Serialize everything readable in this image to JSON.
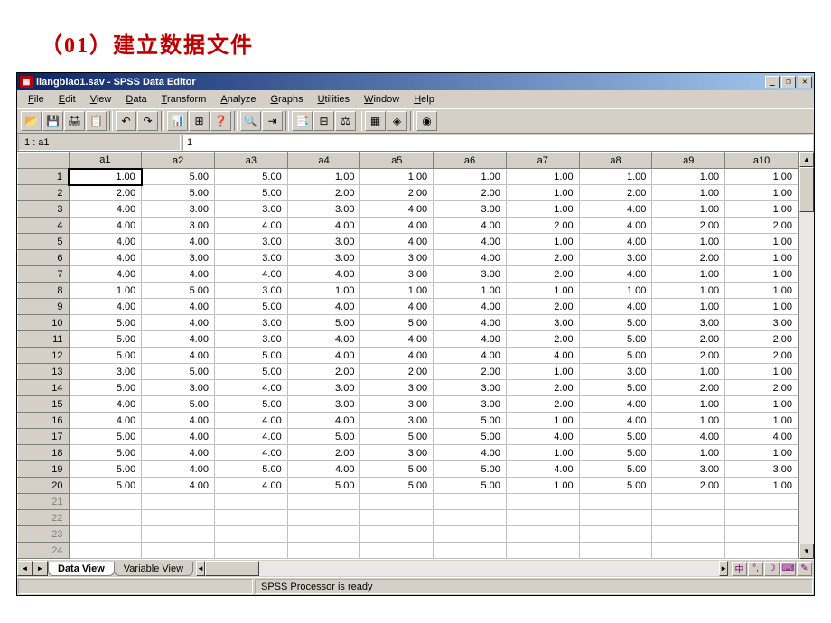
{
  "page_heading": "（01）建立数据文件",
  "window": {
    "title": "liangbiao1.sav - SPSS Data Editor",
    "buttons": {
      "min": "_",
      "max": "❐",
      "close": "✕"
    }
  },
  "menu": [
    "File",
    "Edit",
    "View",
    "Data",
    "Transform",
    "Analyze",
    "Graphs",
    "Utilities",
    "Window",
    "Help"
  ],
  "toolbar_icons": [
    "📂",
    "💾",
    "🖨",
    "📋",
    "↶",
    "↷",
    "📊",
    "⊞",
    "❓",
    "🔍",
    "⇥",
    "📑",
    "⊟",
    "⚖",
    "▦",
    "◈",
    "◉"
  ],
  "indicator": {
    "cell": "1 : a1",
    "value": "1"
  },
  "columns": [
    "a1",
    "a2",
    "a3",
    "a4",
    "a5",
    "a6",
    "a7",
    "a8",
    "a9",
    "a10"
  ],
  "rows": [
    [
      "1.00",
      "5.00",
      "5.00",
      "1.00",
      "1.00",
      "1.00",
      "1.00",
      "1.00",
      "1.00",
      "1.00"
    ],
    [
      "2.00",
      "5.00",
      "5.00",
      "2.00",
      "2.00",
      "2.00",
      "1.00",
      "2.00",
      "1.00",
      "1.00"
    ],
    [
      "4.00",
      "3.00",
      "3.00",
      "3.00",
      "4.00",
      "3.00",
      "1.00",
      "4.00",
      "1.00",
      "1.00"
    ],
    [
      "4.00",
      "3.00",
      "4.00",
      "4.00",
      "4.00",
      "4.00",
      "2.00",
      "4.00",
      "2.00",
      "2.00"
    ],
    [
      "4.00",
      "4.00",
      "3.00",
      "3.00",
      "4.00",
      "4.00",
      "1.00",
      "4.00",
      "1.00",
      "1.00"
    ],
    [
      "4.00",
      "3.00",
      "3.00",
      "3.00",
      "3.00",
      "4.00",
      "2.00",
      "3.00",
      "2.00",
      "1.00"
    ],
    [
      "4.00",
      "4.00",
      "4.00",
      "4.00",
      "3.00",
      "3.00",
      "2.00",
      "4.00",
      "1.00",
      "1.00"
    ],
    [
      "1.00",
      "5.00",
      "3.00",
      "1.00",
      "1.00",
      "1.00",
      "1.00",
      "1.00",
      "1.00",
      "1.00"
    ],
    [
      "4.00",
      "4.00",
      "5.00",
      "4.00",
      "4.00",
      "4.00",
      "2.00",
      "4.00",
      "1.00",
      "1.00"
    ],
    [
      "5.00",
      "4.00",
      "3.00",
      "5.00",
      "5.00",
      "4.00",
      "3.00",
      "5.00",
      "3.00",
      "3.00"
    ],
    [
      "5.00",
      "4.00",
      "3.00",
      "4.00",
      "4.00",
      "4.00",
      "2.00",
      "5.00",
      "2.00",
      "2.00"
    ],
    [
      "5.00",
      "4.00",
      "5.00",
      "4.00",
      "4.00",
      "4.00",
      "4.00",
      "5.00",
      "2.00",
      "2.00"
    ],
    [
      "3.00",
      "5.00",
      "5.00",
      "2.00",
      "2.00",
      "2.00",
      "1.00",
      "3.00",
      "1.00",
      "1.00"
    ],
    [
      "5.00",
      "3.00",
      "4.00",
      "3.00",
      "3.00",
      "3.00",
      "2.00",
      "5.00",
      "2.00",
      "2.00"
    ],
    [
      "4.00",
      "5.00",
      "5.00",
      "3.00",
      "3.00",
      "3.00",
      "2.00",
      "4.00",
      "1.00",
      "1.00"
    ],
    [
      "4.00",
      "4.00",
      "4.00",
      "4.00",
      "3.00",
      "5.00",
      "1.00",
      "4.00",
      "1.00",
      "1.00"
    ],
    [
      "5.00",
      "4.00",
      "4.00",
      "5.00",
      "5.00",
      "5.00",
      "4.00",
      "5.00",
      "4.00",
      "4.00"
    ],
    [
      "5.00",
      "4.00",
      "4.00",
      "2.00",
      "3.00",
      "4.00",
      "1.00",
      "5.00",
      "1.00",
      "1.00"
    ],
    [
      "5.00",
      "4.00",
      "5.00",
      "4.00",
      "5.00",
      "5.00",
      "4.00",
      "5.00",
      "3.00",
      "3.00"
    ],
    [
      "5.00",
      "4.00",
      "4.00",
      "5.00",
      "5.00",
      "5.00",
      "1.00",
      "5.00",
      "2.00",
      "1.00"
    ]
  ],
  "empty_rows": [
    21,
    22,
    23,
    24
  ],
  "tabs": {
    "data_view": "Data View",
    "variable_view": "Variable View"
  },
  "status": "SPSS Processor  is ready",
  "ime_icons": [
    "中",
    "°,",
    "☽",
    "⌨",
    "✎"
  ]
}
